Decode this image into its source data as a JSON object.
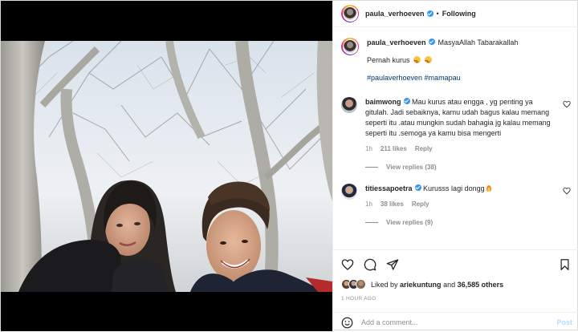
{
  "post": {
    "author": "paula_verhoeven",
    "follow_status": "Following",
    "separator": "•"
  },
  "caption": {
    "username": "paula_verhoeven",
    "line1": "MasyaAllah Tabarakallah",
    "line2": "Pernah kurus",
    "hashtags": "#paulaverhoeven #mamapau"
  },
  "comments": [
    {
      "username": "baimwong",
      "text": "Mau kurus atau engga , yg penting ya gitulah. Jadi sebaiknya, kamu udah bagus kalau memang seperti itu .atau mungkin sudah bahagia jg kalau memang seperti itu .semoga ya kamu bisa mengerti",
      "time": "1h",
      "likes": "211 likes",
      "reply": "Reply",
      "view_replies": "View replies (38)"
    },
    {
      "username": "titiessapoetra",
      "text": "Kurusss lagi dongg",
      "time": "1h",
      "likes": "38 likes",
      "reply": "Reply",
      "view_replies": "View replies (9)"
    }
  ],
  "engagement": {
    "liked_by_prefix": "Liked by",
    "liked_by_user": "ariekuntung",
    "liked_by_and": "and",
    "liked_by_others": "36,585 others",
    "time_ago": "1 HOUR AGO"
  },
  "composer": {
    "placeholder": "Add a comment...",
    "post_label": "Post"
  },
  "icons": {
    "like": "heart-icon",
    "comment": "comment-icon",
    "share": "paper-plane-icon",
    "save": "bookmark-icon",
    "emoji": "smiley-icon",
    "verified": "verified-badge-icon"
  },
  "colors": {
    "verified": "#3897f0",
    "hashtag": "#00376b",
    "muted": "#8e8e8e",
    "post_button": "#b3dbff"
  }
}
